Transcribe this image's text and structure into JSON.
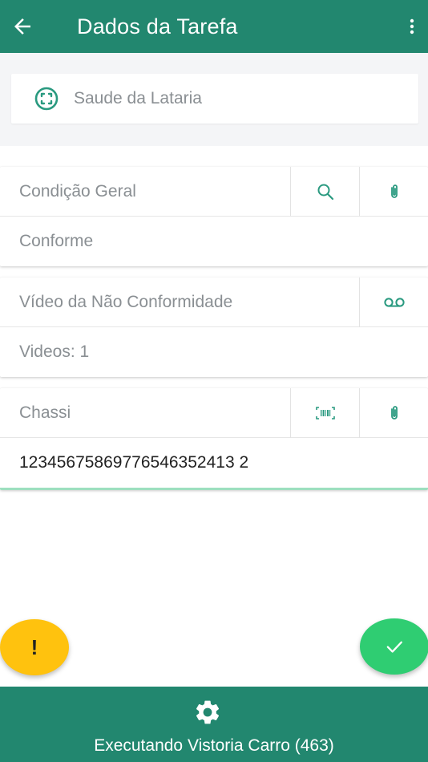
{
  "appbar": {
    "title": "Dados da Tarefa",
    "back_icon": "arrow-left-icon",
    "menu_icon": "more-vertical-icon"
  },
  "header": {
    "icon": "scan-frame-icon",
    "label": "Saude da Lataria"
  },
  "fields": [
    {
      "label": "Condição Geral",
      "value": "Conforme",
      "actions": [
        "search-icon",
        "paperclip-icon"
      ]
    },
    {
      "label": "Vídeo da Não Conformidade",
      "value": "Videos: 1",
      "actions": [
        "voicemail-icon"
      ]
    },
    {
      "label": "Chassi",
      "value": "12345675869776546352413 2",
      "actions": [
        "barcode-icon",
        "paperclip-icon"
      ]
    }
  ],
  "fab_warning": {
    "label": "!",
    "color": "#ffc20e"
  },
  "fab_confirm": {
    "icon": "check-icon",
    "color": "#2fcd72"
  },
  "bottombar": {
    "icon": "gear-icon",
    "status": "Executando Vistoria Carro (463)"
  },
  "colors": {
    "primary": "#22876f",
    "accent_icon": "#2a9a80"
  }
}
